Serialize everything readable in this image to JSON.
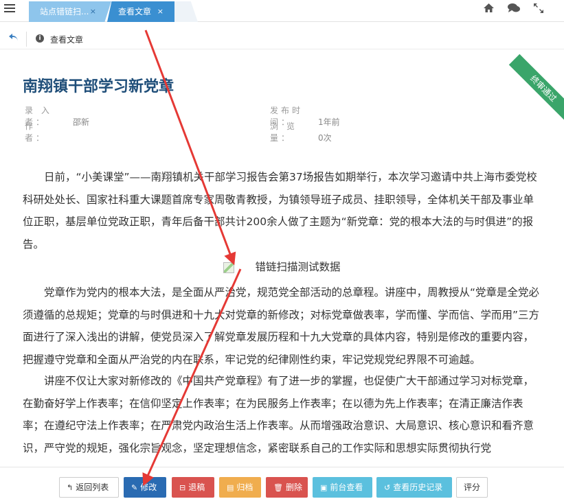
{
  "tabs": [
    {
      "label": "站点错链扫...",
      "close": "×"
    },
    {
      "label": "查看文章",
      "close": "×"
    }
  ],
  "breadcrumb": {
    "label": "查看文章"
  },
  "article": {
    "title": "南翔镇干部学习新党章",
    "status_ribbon": "终审通过",
    "meta": {
      "recorder_label": "录 入 者：",
      "recorder_value": "邵新",
      "author_label": "作　　者：",
      "author_value": "",
      "publish_label": "发布时间：",
      "publish_value": "1年前",
      "views_label": "浏 览 量：",
      "views_value": "0次"
    },
    "paragraph1": "日前，“小美课堂”——南翔镇机关干部学习报告会第37场报告如期举行，本次学习邀请中共上海市委党校科研处处长、国家社科重大课题首席专家周敬青教授，为镇领导班子成员、挂职领导，全体机关干部及事业单位正职，基层单位党政正职，青年后备干部共计200余人做了主题为“新党章：党的根本大法的与时俱进”的报告。",
    "image_alt": "错链扫描测试数据",
    "paragraph2": "党章作为党内的根本大法，是全面从严治党，规范党全部活动的总章程。讲座中，周教授从“党章是全党必须遵循的总规矩；党章的与时俱进和十九大对党章的新修改；对标党章做表率，学而懂、学而信、学而用”三方面进行了深入浅出的讲解，使党员深入了解党章发展历程和十九大党章的具体内容，特别是修改的重要内容，把握遵守党章和全面从严治党的内在联系，牢记党的纪律刚性约束，牢记党规党纪界限不可逾越。",
    "paragraph3": "讲座不仅让大家对新修改的《中国共产党章程》有了进一步的掌握，也促使广大干部通过学习对标党章，在勤奋好学上作表率；在信仰坚定上作表率；在为民服务上作表率；在以德为先上作表率；在清正廉洁作表率；在遵纪守法上作表率；在严肃党内政治生活上作表率。从而增强政治意识、大局意识、核心意识和看齐意识，严守党的规矩，强化宗旨观念，坚定理想信念，紧密联系自己的工作实际和思想实际贯彻执行党"
  },
  "toolbar": {
    "back": "返回列表",
    "edit": "修改",
    "reject": "退稿",
    "archive": "归档",
    "delete": "删除",
    "front_view": "前台查看",
    "history": "查看历史记录",
    "rate": "评分"
  },
  "colors": {
    "primary": "#2a6bb2",
    "danger": "#d9534f",
    "warning": "#f0ad4e",
    "info": "#5bc0de",
    "ribbon": "#3aa56a",
    "annotation": "#e53935"
  }
}
